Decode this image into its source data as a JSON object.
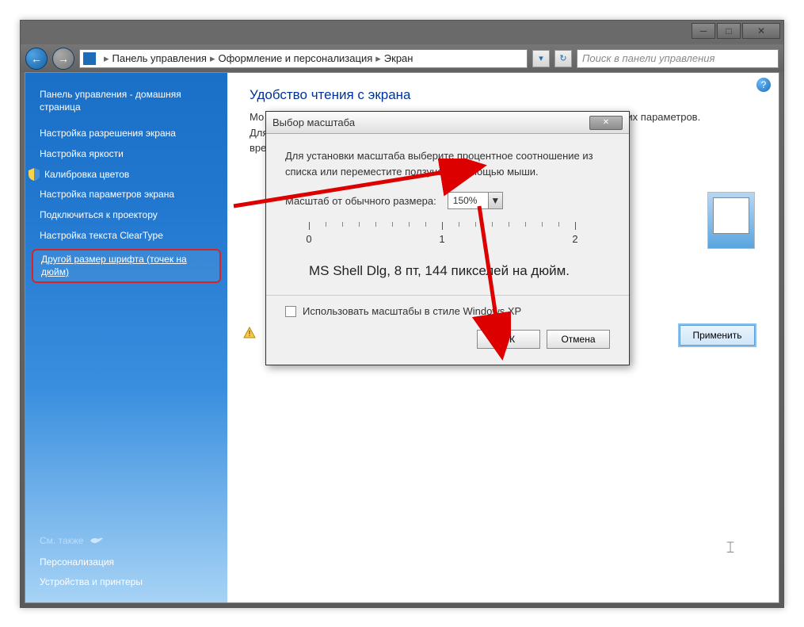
{
  "breadcrumb": {
    "items": [
      "Панель управления",
      "Оформление и персонализация",
      "Экран"
    ]
  },
  "search": {
    "placeholder": "Поиск в панели управления"
  },
  "sidebar": {
    "home": "Панель управления - домашняя страница",
    "links": [
      "Настройка разрешения экрана",
      "Настройка яркости",
      "Калибровка цветов",
      "Настройка параметров экрана",
      "Подключиться к проектору",
      "Настройка текста ClearType"
    ],
    "highlighted": "Другой размер шрифта (точек на дюйм)",
    "see_also_title": "См. также",
    "footer_links": [
      "Персонализация",
      "Устройства и принтеры"
    ]
  },
  "main": {
    "heading": "Удобство чтения с экрана",
    "desc_prefix": "Мо",
    "desc_suffix": "тих параметров. Для",
    "desc_line2": "вре",
    "apply": "Применить"
  },
  "dialog": {
    "title": "Выбор масштаба",
    "desc": "Для установки масштаба выберите процентное соотношение из списка или переместите ползунок с помощью мыши.",
    "scale_label": "Масштаб от обычного размера:",
    "scale_value": "150%",
    "ruler_labels": [
      "0",
      "1",
      "2"
    ],
    "sample": "MS Shell Dlg, 8 пт, 144 пикселей на дюйм.",
    "checkbox": "Использовать масштабы в стиле Windows XP",
    "ok": "ОК",
    "cancel": "Отмена"
  }
}
